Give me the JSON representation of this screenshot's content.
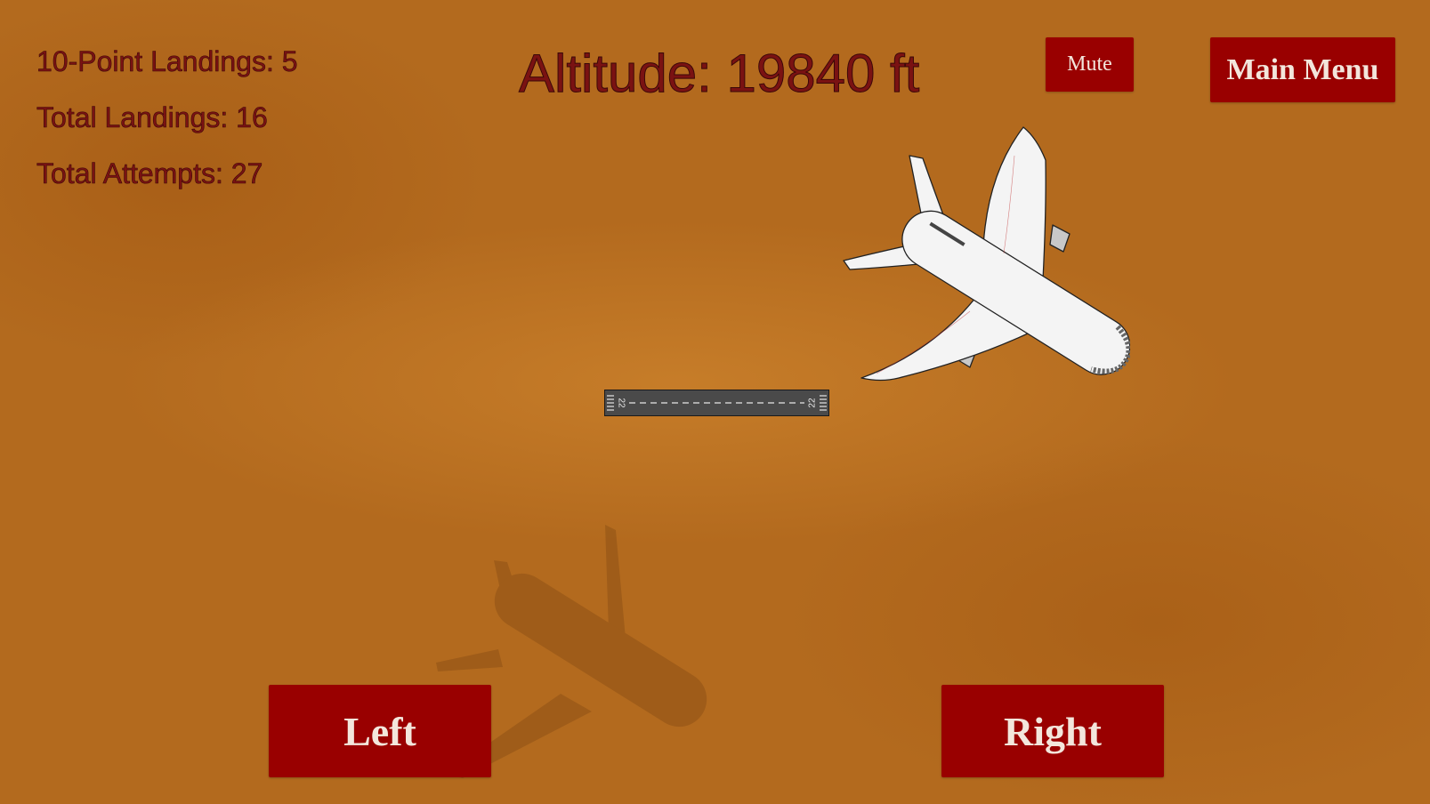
{
  "stats": {
    "ten_point_landings": "10-Point Landings: 5",
    "total_landings": "Total Landings: 16",
    "total_attempts": "Total Attempts: 27"
  },
  "altitude": "Altitude: 19840 ft",
  "buttons": {
    "mute": "Mute",
    "main_menu": "Main Menu",
    "left": "Left",
    "right": "Right"
  },
  "runway": {
    "number": "22"
  },
  "colors": {
    "background": "#b36a1e",
    "button": "#990000",
    "text": "#7a1212"
  }
}
